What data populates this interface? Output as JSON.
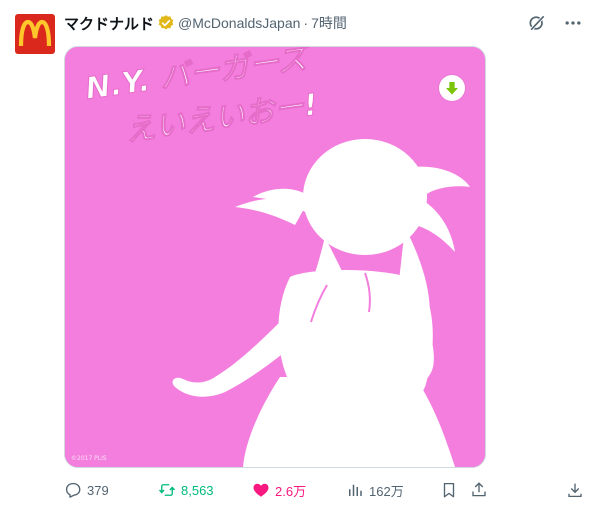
{
  "post": {
    "display_name": "マクドナルド",
    "handle": "@McDonaldsJapan",
    "separator": "·",
    "time": "7時間",
    "image": {
      "headline_line1": "N.Y. バーガーズ",
      "headline_line2": "えいえいおー!",
      "copyright": "©2017 PLIS",
      "background_color": "#f47ede"
    }
  },
  "metrics": {
    "replies": "379",
    "reposts": "8,563",
    "likes": "2.6万",
    "views": "162万"
  },
  "icons": {
    "top": [
      "grok-icon",
      "more-icon"
    ],
    "actions": [
      "reply-icon",
      "repost-icon",
      "like-icon",
      "views-icon",
      "bookmark-icon",
      "share-icon",
      "download-icon"
    ]
  },
  "colors": {
    "brand_red": "#da291c",
    "brand_yellow": "#ffc72c",
    "repost_green": "#00ba7c",
    "like_pink": "#f91880",
    "muted": "#536471"
  }
}
